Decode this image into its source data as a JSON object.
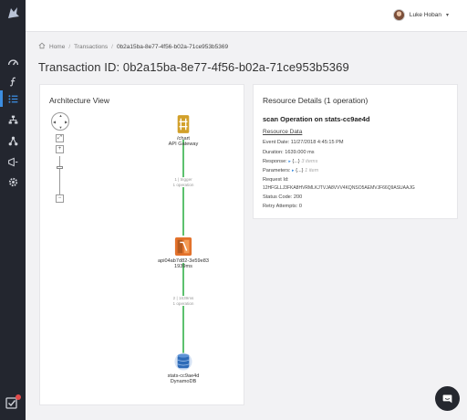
{
  "user": {
    "name": "Luke Hoban"
  },
  "breadcrumb": {
    "home": "Home",
    "transactions": "Transactions",
    "current": "0b2a15ba-8e77-4f56-b02a-71ce953b5369"
  },
  "page_title": "Transaction ID: 0b2a15ba-8e77-4f56-b02a-71ce953b5369",
  "architecture": {
    "title": "Architecture View",
    "zoom_in": "+",
    "zoom_out": "−",
    "fit": "⤢",
    "nodes": [
      {
        "line1": "/chart",
        "line2": "API Gateway",
        "icon": "api-gateway-icon"
      },
      {
        "line1": "api04ab7d82-3e59e83",
        "line2": "1939ms",
        "icon": "lambda-icon"
      },
      {
        "line1": "stats-cc9ae4d",
        "line2": "DynamoDB",
        "icon": "dynamodb-icon"
      }
    ],
    "edges": [
      {
        "line1": "1 | trigger",
        "line2": "1 operation"
      },
      {
        "line1": "2 | 1639ms",
        "line2": "1 operation"
      }
    ]
  },
  "details": {
    "title": "Resource Details (1 operation)",
    "operation": "scan Operation on stats-cc9ae4d",
    "section": "Resource Data",
    "event_date_label": "Event Date:",
    "event_date": "11/27/2018 4:45:15 PM",
    "duration_label": "Duration:",
    "duration": "1639.000 ms",
    "response_label": "Response:",
    "response_value": "{...}",
    "response_count": "3 items",
    "parameters_label": "Parameters:",
    "parameters_value": "{...}",
    "parameters_count": "1 item",
    "request_id_label": "Request Id:",
    "request_id": "12HFGLLJ3FKA8HVRMLKJTVJA8VVV4KQNSO5AEMVJF66Q9ASUAAJG",
    "status_code_label": "Status Code:",
    "status_code": "200",
    "retry_label": "Retry Attempts:",
    "retry": "0"
  },
  "colors": {
    "accent": "#3c8de0",
    "edge": "#5cc16e",
    "sidebar": "#23262f"
  }
}
